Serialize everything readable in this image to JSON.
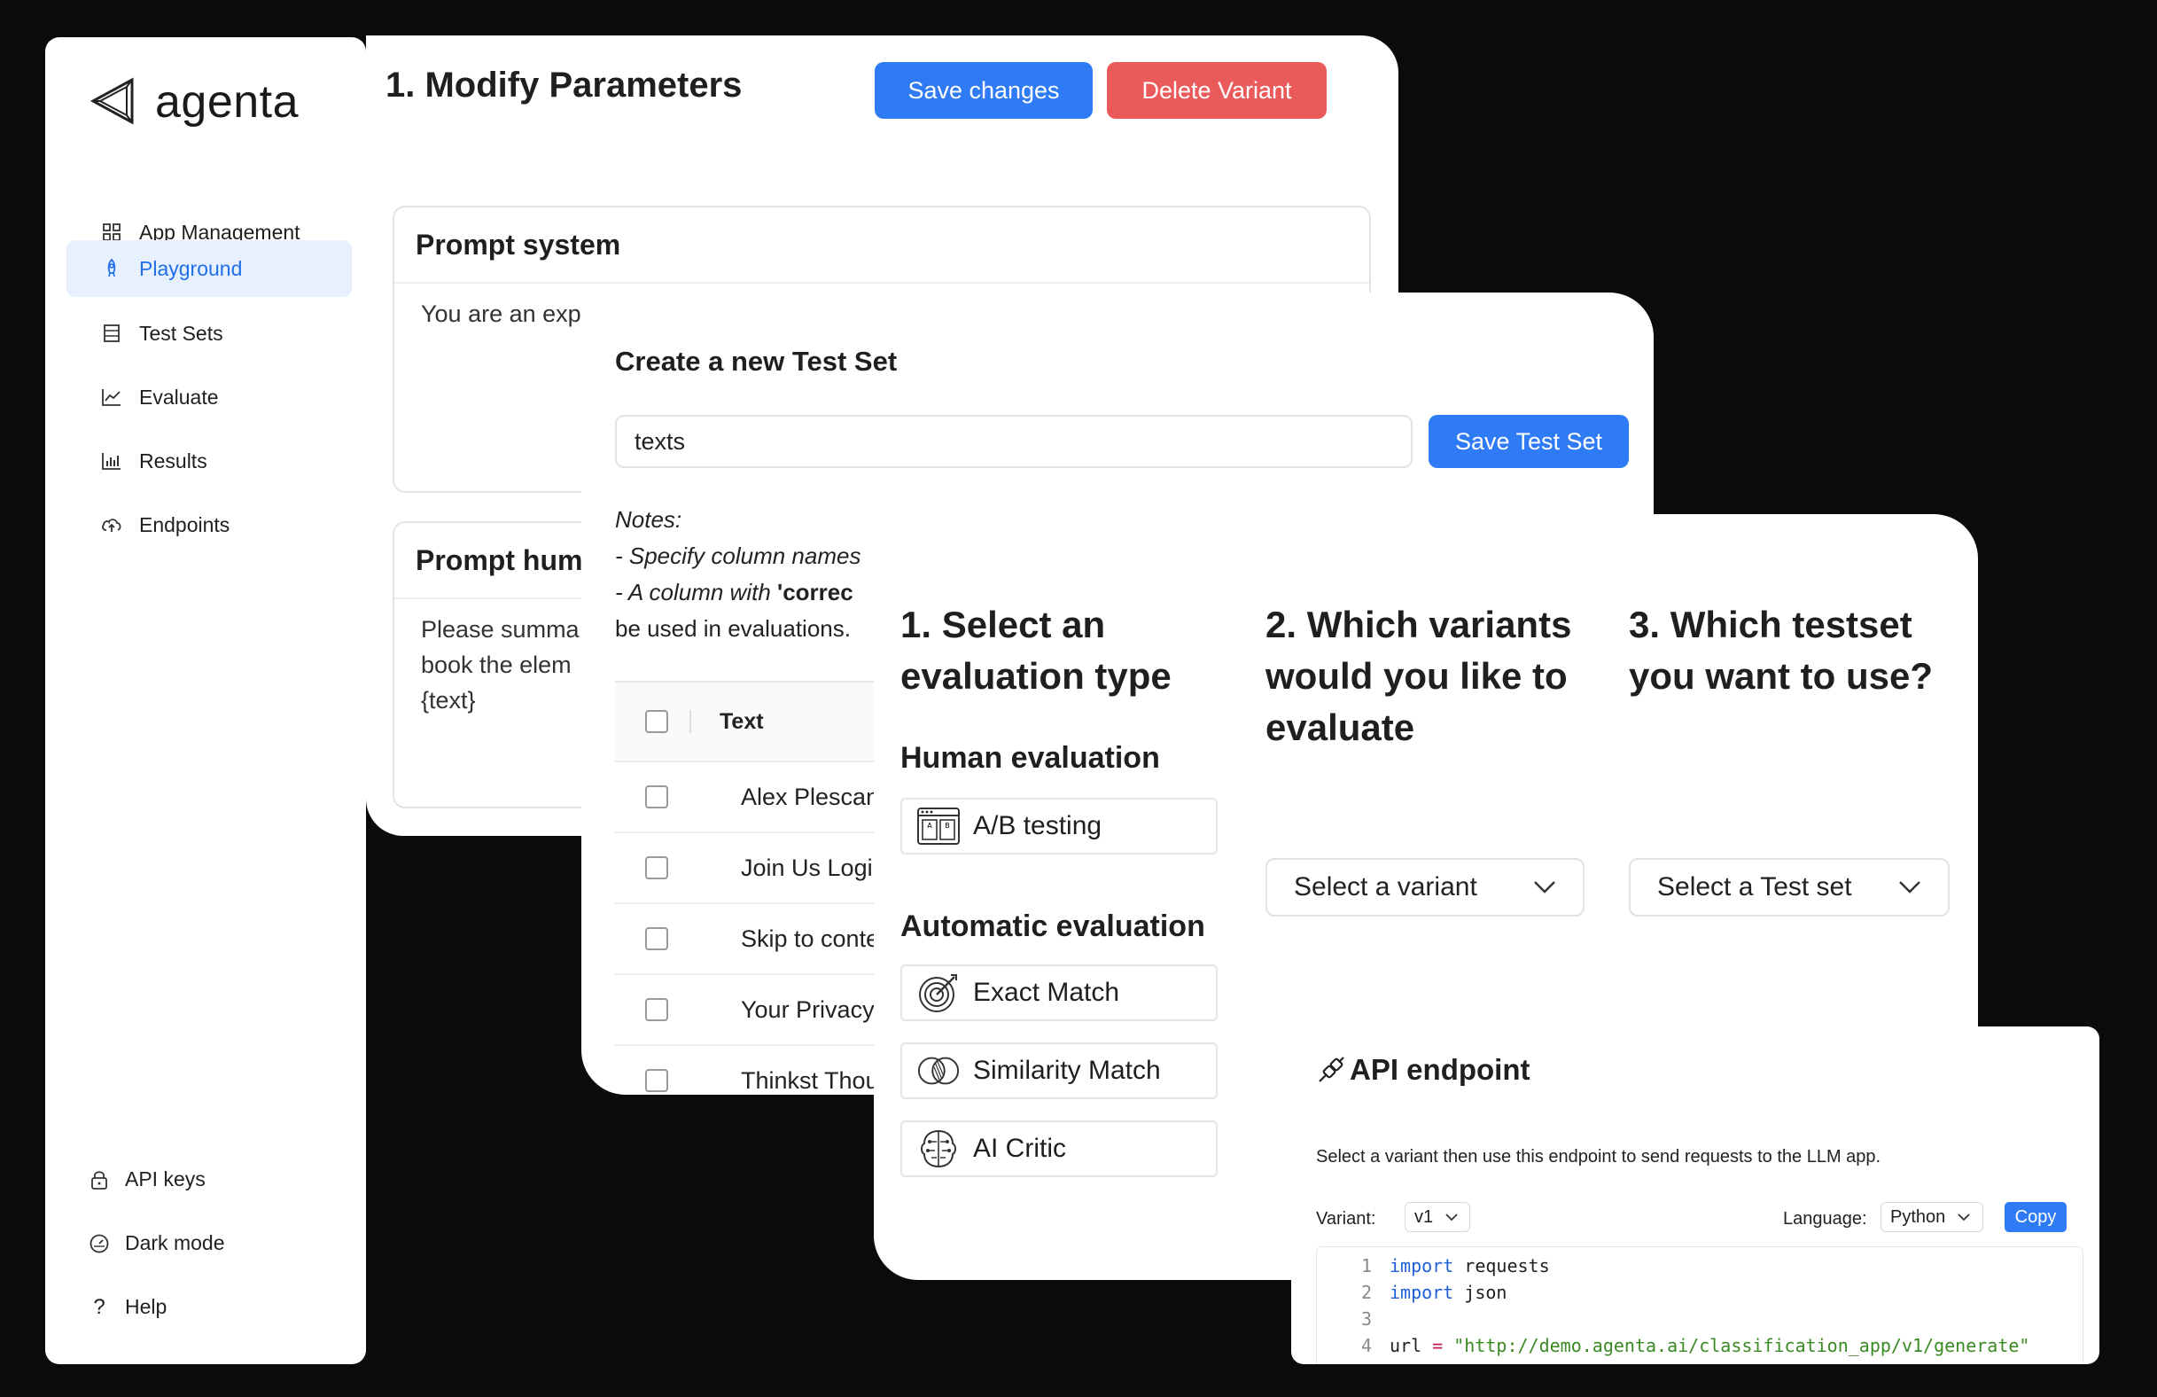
{
  "sidebar": {
    "logo_text": "agenta",
    "items": [
      {
        "label": "App Management",
        "icon": "grid-icon"
      },
      {
        "label": "Playground",
        "icon": "rocket-icon",
        "active": true
      },
      {
        "label": "Test Sets",
        "icon": "database-icon"
      },
      {
        "label": "Evaluate",
        "icon": "line-chart-icon"
      },
      {
        "label": "Results",
        "icon": "bar-chart-icon"
      },
      {
        "label": "Endpoints",
        "icon": "cloud-upload-icon"
      }
    ],
    "bottom": [
      {
        "label": "API keys",
        "icon": "lock-icon"
      },
      {
        "label": "Dark mode",
        "icon": "dashboard-icon"
      },
      {
        "label": "Help",
        "icon": "question-icon"
      }
    ]
  },
  "modify": {
    "title": "1. Modify Parameters",
    "save_label": "Save changes",
    "delete_label": "Delete Variant",
    "prompt_system": {
      "title": "Prompt system",
      "text": "You are an exp"
    },
    "prompt_human": {
      "title": "Prompt hum",
      "text": "Please summa\nbook the elem\n{text}"
    }
  },
  "testset": {
    "title": "Create a new Test Set",
    "name_value": "texts",
    "save_label": "Save Test Set",
    "notes": {
      "line1": "Notes:",
      "line2": "- Specify column names",
      "line3_a": "- A column with ",
      "line3_b": "'correc",
      "line4": "be used in evaluations."
    },
    "table": {
      "header": "Text",
      "rows": [
        "Alex Plescan",
        "Join Us Login",
        "Skip to conte",
        "Your Privacy",
        "Thinkst Thou"
      ]
    }
  },
  "evaluation": {
    "col1_title": "1. Select an evaluation type",
    "col2_title": "2. Which variants would you like to evaluate",
    "col3_title": "3. Which testset you want to use?",
    "human_title": "Human evaluation",
    "human_options": [
      {
        "label": "A/B testing",
        "icon": "ab-testing-icon"
      }
    ],
    "auto_title": "Automatic evaluation",
    "auto_options": [
      {
        "label": "Exact Match",
        "icon": "target-icon"
      },
      {
        "label": "Similarity Match",
        "icon": "venn-icon"
      },
      {
        "label": "AI Critic",
        "icon": "brain-icon"
      }
    ],
    "variant_placeholder": "Select a variant",
    "testset_placeholder": "Select a Test set"
  },
  "api": {
    "title": "API endpoint",
    "description": "Select a variant then use this endpoint to send requests to the LLM app.",
    "variant_label": "Variant:",
    "variant_value": "v1",
    "language_label": "Language:",
    "language_value": "Python",
    "copy_label": "Copy",
    "code": [
      {
        "n": "1",
        "kw": "import",
        "rest": " requests"
      },
      {
        "n": "2",
        "kw": "import",
        "rest": " json"
      },
      {
        "n": "3",
        "kw": "",
        "rest": ""
      },
      {
        "n": "4",
        "var": "url",
        "op": " = ",
        "str": "\"http://demo.agenta.ai/classification_app/v1/generate\""
      }
    ]
  },
  "colors": {
    "accent": "#2f7bf5",
    "danger": "#eb5a5a",
    "active_bg": "#e6f0ff",
    "background": "#0b0b0d"
  }
}
